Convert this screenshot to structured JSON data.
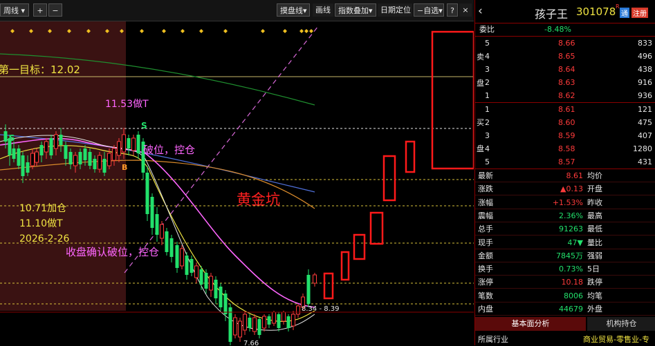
{
  "toolbar": {
    "cycle_select": "周线",
    "zoom_in": "+",
    "zoom_out": "−",
    "draw_line": "摸盘线",
    "draw_mode": "画线",
    "index_overlay": "指数叠加",
    "date_locate": "日期定位",
    "watchlist": "自选",
    "help": "?",
    "close": "×"
  },
  "chart": {
    "target_label": "第一目标：12.02",
    "t_label": "11.53做T",
    "break_label": "破位，控仓",
    "pit_label": "黄金坑",
    "add_label": "10.71加仓",
    "t2_label": "11.10做T",
    "date_label": "2026-2-26",
    "close_break_label": "收盘确认破位，控仓",
    "price_tip": "8.34 - 8.39",
    "low_label": "7.66",
    "s_marker": "S",
    "b_marker": "B"
  },
  "quote": {
    "back_icon": "chevron-left-icon",
    "stock_name": "孩子王",
    "stock_code": "301078",
    "badge_r": "R",
    "badge_tong": "通",
    "badge_reg": "注册",
    "weibi_label": "委比",
    "weibi_value": "-8.48%",
    "sell_side": [
      "卖",
      "盘"
    ],
    "buy_side": [
      "买",
      "盘"
    ],
    "asks": [
      {
        "level": "5",
        "price": "8.66",
        "vol": "833"
      },
      {
        "level": "4",
        "price": "8.65",
        "vol": "496"
      },
      {
        "level": "3",
        "price": "8.64",
        "vol": "438"
      },
      {
        "level": "2",
        "price": "8.63",
        "vol": "916"
      },
      {
        "level": "1",
        "price": "8.62",
        "vol": "936"
      }
    ],
    "bids": [
      {
        "level": "1",
        "price": "8.61",
        "vol": "121"
      },
      {
        "level": "2",
        "price": "8.60",
        "vol": "475"
      },
      {
        "level": "3",
        "price": "8.59",
        "vol": "407"
      },
      {
        "level": "4",
        "price": "8.58",
        "vol": "1280"
      },
      {
        "level": "5",
        "price": "8.57",
        "vol": "431"
      }
    ],
    "stats": [
      {
        "label": "最新",
        "value": "8.61",
        "label2": "均价",
        "value2": ""
      },
      {
        "label": "涨跌",
        "value": "▲0.13",
        "label2": "开盘",
        "value2": ""
      },
      {
        "label": "涨幅",
        "value": "+1.53%",
        "label2": "昨收",
        "value2": ""
      },
      {
        "label": "震幅",
        "value": "2.36%",
        "label2": "最高",
        "value2": ""
      },
      {
        "label": "总手",
        "value": "91263",
        "label2": "最低",
        "value2": ""
      },
      {
        "label": "现手",
        "value": "47▼",
        "label2": "量比",
        "value2": ""
      },
      {
        "label": "金额",
        "value": "7845万",
        "label2": "强弱",
        "value2": ""
      },
      {
        "label": "换手",
        "value": "0.73%",
        "label2": "5日",
        "value2": ""
      },
      {
        "label": "涨停",
        "value": "10.18",
        "label2": "跌停",
        "value2": ""
      },
      {
        "label": "笔数",
        "value": "8006",
        "label2": "均笔",
        "value2": ""
      },
      {
        "label": "内盘",
        "value": "44679",
        "label2": "外盘",
        "value2": ""
      }
    ],
    "tab_fundamental": "基本面分析",
    "tab_institution": "机构持仓",
    "industry_label": "所属行业",
    "industry_value": "商业贸易-零售业-专"
  },
  "colors": {
    "up": "#ff3b3b",
    "down": "#22e06b",
    "highlight_band": "#3a1212",
    "dashed_yellow": "#d8c23a",
    "pink_ma": "#ff66ff",
    "yellow_ma": "#f0e442",
    "orange_ma": "#d98a2b",
    "blue_ma": "#4f6fd8",
    "green_ma": "#1f8f2f"
  }
}
